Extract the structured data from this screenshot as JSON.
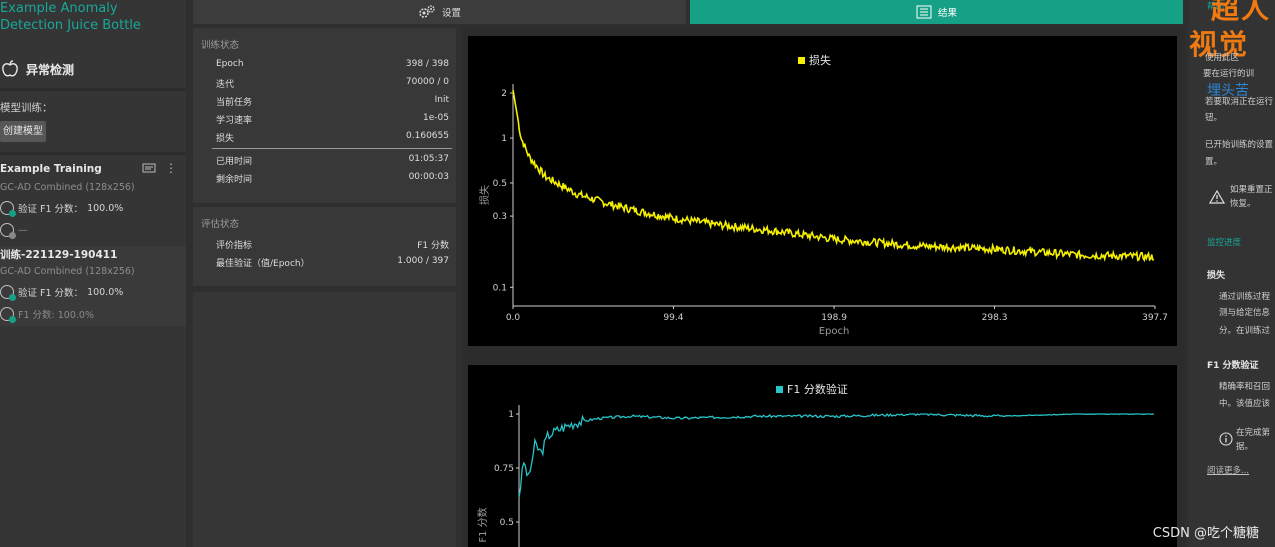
{
  "sidebar": {
    "project_title_line1": "Example Anomaly",
    "project_title_line2": "Detection Juice Bottle",
    "section_label": "异常检测",
    "model_training_label": "模型训练：",
    "create_model_button": "创建模型",
    "trainings": [
      {
        "name": "Example Training",
        "model": "GC-AD Combined (128x256)",
        "metric_label": "验证 F1 分数：",
        "metric_value": "100.0%",
        "extra": "—"
      },
      {
        "name": "训练-221129-190411",
        "model": "GC-AD Combined (128x256)",
        "metric_label": "验证 F1 分数：",
        "metric_value": "100.0%",
        "extra": "F1 分数: 100.0%"
      }
    ]
  },
  "tabs": [
    {
      "label": "设置",
      "icon": "gears-icon",
      "active": false
    },
    {
      "label": "结果",
      "icon": "list-icon",
      "active": true
    }
  ],
  "training_status": {
    "title": "训练状态",
    "rows": [
      {
        "label": "Epoch",
        "value": "398 / 398"
      },
      {
        "label": "迭代",
        "value": "70000 / 0"
      },
      {
        "label": "当前任务",
        "value": "Init"
      },
      {
        "label": "学习速率",
        "value": "1e-05"
      },
      {
        "label": "损失",
        "value": "0.160655"
      }
    ],
    "time_rows": [
      {
        "label": "已用时间",
        "value": "01:05:37"
      },
      {
        "label": "剩余时间",
        "value": "00:00:03"
      }
    ]
  },
  "eval_status": {
    "title": "评估状态",
    "rows": [
      {
        "label": "评价指标",
        "value": "F1 分数"
      },
      {
        "label": "最佳验证（值/Epoch）",
        "value": "1.000 / 397"
      }
    ]
  },
  "chart_data": [
    {
      "type": "line",
      "legend": "损失",
      "color": "#f5f000",
      "xlabel": "Epoch",
      "ylabel": "损失",
      "xlim": [
        0.0,
        397.7
      ],
      "xticks": [
        "0.0",
        "99.4",
        "198.9",
        "298.3",
        "397.7"
      ],
      "yticks": [
        "2",
        "1",
        "0.5",
        "0.3",
        "0.1"
      ],
      "yscale": "log",
      "x": [
        0,
        5,
        10,
        20,
        40,
        60,
        80,
        100,
        130,
        160,
        200,
        250,
        300,
        350,
        397
      ],
      "y": [
        2.1,
        1.0,
        0.75,
        0.55,
        0.42,
        0.36,
        0.32,
        0.29,
        0.26,
        0.24,
        0.21,
        0.19,
        0.18,
        0.165,
        0.16
      ]
    },
    {
      "type": "line",
      "legend": "F1 分数验证",
      "color": "#27c4c8",
      "ylabel": "F1 分数",
      "yticks": [
        "1",
        "0.75",
        "0.5"
      ],
      "x": [
        0,
        3,
        6,
        10,
        14,
        18,
        25,
        35,
        50,
        70,
        100,
        150,
        200,
        250,
        300,
        350,
        397
      ],
      "y": [
        0.62,
        0.78,
        0.7,
        0.86,
        0.82,
        0.9,
        0.93,
        0.96,
        0.98,
        0.99,
        0.98,
        0.99,
        0.99,
        1.0,
        0.99,
        1.0,
        1.0
      ]
    }
  ],
  "help": {
    "title_overlay_1": "超人",
    "title_overlay_2": "视觉",
    "blue_overlay": "埋头苦",
    "tab_label": "帮助",
    "line1": "使用此区",
    "line2": "要在运行的训",
    "line3": "若要取消正在运行",
    "line4": "钮。",
    "line5": "已开始训练的设置",
    "line6": "置。",
    "warning_line1": "如果重置正",
    "warning_line2": "恢复。",
    "monitor_link": "监控进度",
    "loss_title": "损失",
    "loss_line1": "通过训练过程",
    "loss_line2": "测与给定信息",
    "loss_line3": "分。在训练过",
    "f1_title": "F1 分数验证",
    "f1_line1": "精确率和召回",
    "f1_line2": "中。该值应该",
    "info_line1": "在完成第",
    "info_line2": "据。",
    "read_more": "阅读更多..."
  },
  "watermark": "CSDN @吃个糖糖"
}
